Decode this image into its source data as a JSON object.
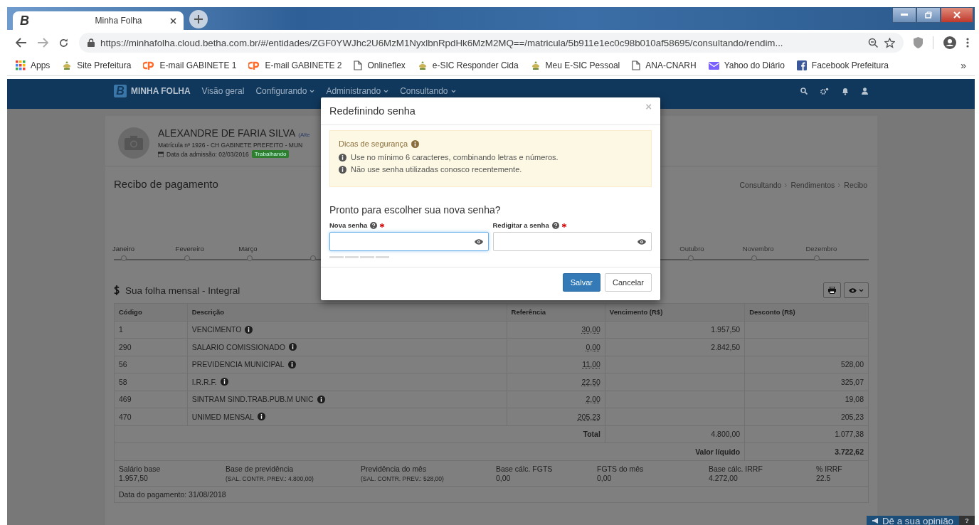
{
  "browser": {
    "tab_logo": "B",
    "tab_title": "Minha Folha",
    "url": "https://minhafolha.cloud.betha.com.br/#/entidades/ZGF0YWJhc2U6MzM1NyxlbnRpdHk6MzM2MQ==/matricula/5b911e1ec0c98b010af58695/consultando/rendim...",
    "bookmarks": [
      {
        "kind": "apps",
        "label": "Apps"
      },
      {
        "kind": "crest",
        "label": "Site Prefeitura"
      },
      {
        "kind": "cpanel",
        "label": "E-mail GABINETE 1"
      },
      {
        "kind": "cpanel",
        "label": "E-mail GABINETE 2"
      },
      {
        "kind": "page",
        "label": "Onlineflex"
      },
      {
        "kind": "crest",
        "label": "e-SIC Responder Cida"
      },
      {
        "kind": "crest",
        "label": "Meu E-SIC Pessoal"
      },
      {
        "kind": "page",
        "label": "ANA-CNARH"
      },
      {
        "kind": "mail",
        "label": "Yahoo do Diário"
      },
      {
        "kind": "facebook",
        "label": "Facebook Prefeitura"
      }
    ],
    "more": "»"
  },
  "nav": {
    "logo": "B",
    "brand": "MINHA FOLHA",
    "items": [
      {
        "label": "Visão geral",
        "dropdown": false
      },
      {
        "label": "Configurando",
        "dropdown": true
      },
      {
        "label": "Administrando",
        "dropdown": true
      },
      {
        "label": "Consultando",
        "dropdown": true
      }
    ]
  },
  "profile": {
    "name": "ALEXANDRE DE FARIA SILVA",
    "name_suffix": "(Alte",
    "matricula": "Matrícula nº 1926 - CH GABINETE PREFEITO - MUN",
    "admission": "Data da admissão: 02/03/2016",
    "status": "Trabalhando"
  },
  "page_title": "Recibo de pagamento",
  "breadcrumb": [
    "Consultando",
    "Rendimentos",
    "Recibo"
  ],
  "timeline": {
    "months_left": [
      "Janeiro",
      "Fevereiro",
      "Março"
    ],
    "months_right": [
      "Outubro",
      "Novembro",
      "Dezembro"
    ]
  },
  "section_title": "Sua folha mensal - Integral",
  "table": {
    "columns": [
      "Código",
      "Descrição",
      "Referência",
      "Vencimento (R$)",
      "Desconto (R$)"
    ],
    "rows": [
      {
        "code": "1",
        "description": "VENCIMENTO",
        "reference": "30,00",
        "earning": "1.957,50",
        "discount": ""
      },
      {
        "code": "290",
        "description": "SALARIO COMISSIONADO",
        "reference": "0,00",
        "earning": "2.842,50",
        "discount": ""
      },
      {
        "code": "56",
        "description": "PREVIDENCIA MUNICIPAL",
        "reference": "11,00",
        "earning": "",
        "discount": "528,00"
      },
      {
        "code": "58",
        "description": "I.R.R.F.",
        "reference": "22,50",
        "earning": "",
        "discount": "325,07"
      },
      {
        "code": "469",
        "description": "SINTRAM SIND.TRAB.PUB.M UNIC",
        "reference": "2,00",
        "earning": "",
        "discount": "19,08"
      },
      {
        "code": "470",
        "description": "UNIMED MENSAL",
        "reference": "205,23",
        "earning": "",
        "discount": "205,23"
      }
    ],
    "total": {
      "label": "Total",
      "earning": "4.800,00",
      "discount": "1.077,38"
    },
    "net": {
      "label": "Valor líquido",
      "value": "3.722,62"
    },
    "bases": [
      {
        "label": "Salário base",
        "value": "1.957,50",
        "small": false
      },
      {
        "label": "Base de previdência",
        "value": "(SAL. CONTR. PREV.: 4.800,00)",
        "small": true
      },
      {
        "label": "Previdência do mês",
        "value": "(SAL. CONTR. PREV.: 528,00)",
        "small": true
      },
      {
        "label": "Base cálc. FGTS",
        "value": "0,00",
        "small": false
      },
      {
        "label": "FGTS do mês",
        "value": "0,00",
        "small": false
      },
      {
        "label": "Base cálc. IRRF",
        "value": "4.272,00",
        "small": false
      },
      {
        "label": "% IRRF",
        "value": "22.5",
        "small": false
      }
    ],
    "payment_date": "Data do pagamento: 31/08/2018"
  },
  "modal": {
    "title": "Redefinindo senha",
    "close": "×",
    "tips_title": "Dicas de segurança",
    "tips": [
      "Use no mínimo 6 caracteres, combinando letras e números.",
      "Não use senha utilizadas conosco recentemente."
    ],
    "question": "Pronto para escolher sua nova senha?",
    "fields": [
      {
        "label": "Nova senha",
        "required": true,
        "focused": true
      },
      {
        "label": "Redigitar a senha",
        "required": true,
        "focused": false
      }
    ],
    "buttons": [
      {
        "label": "Salvar",
        "kind": "primary"
      },
      {
        "label": "Cancelar",
        "kind": "default"
      }
    ]
  },
  "feedback": {
    "label": "Dê a sua opinião",
    "help": "?"
  }
}
